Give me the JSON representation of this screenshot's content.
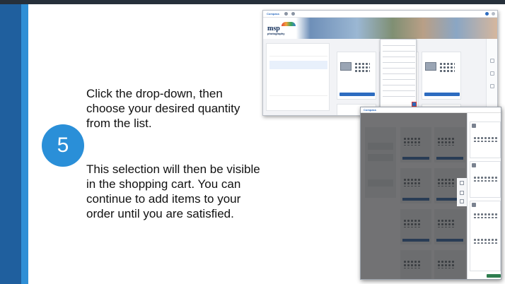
{
  "slide": {
    "step_number": "5",
    "instruction_1": "Click the drop-down, then choose your desired quantity from the list.",
    "instruction_2": "This selection will then be visible in the shopping cart. You can continue to add items to your order until you are satisfied."
  },
  "colors": {
    "accent_dark": "#1f5f9e",
    "accent_light": "#2f8fd6",
    "circle": "#2a8fd8",
    "app_blue": "#2d6cc0"
  },
  "screenshot_1": {
    "app_name": "Compass",
    "logo_main": "msp",
    "logo_sub": "photography"
  },
  "screenshot_2": {
    "app_name": "Compass"
  },
  "icons": [
    "compass-logo-icon",
    "bell-icon",
    "user-avatar-icon",
    "cart-icon",
    "dropdown-arrow-icon"
  ]
}
